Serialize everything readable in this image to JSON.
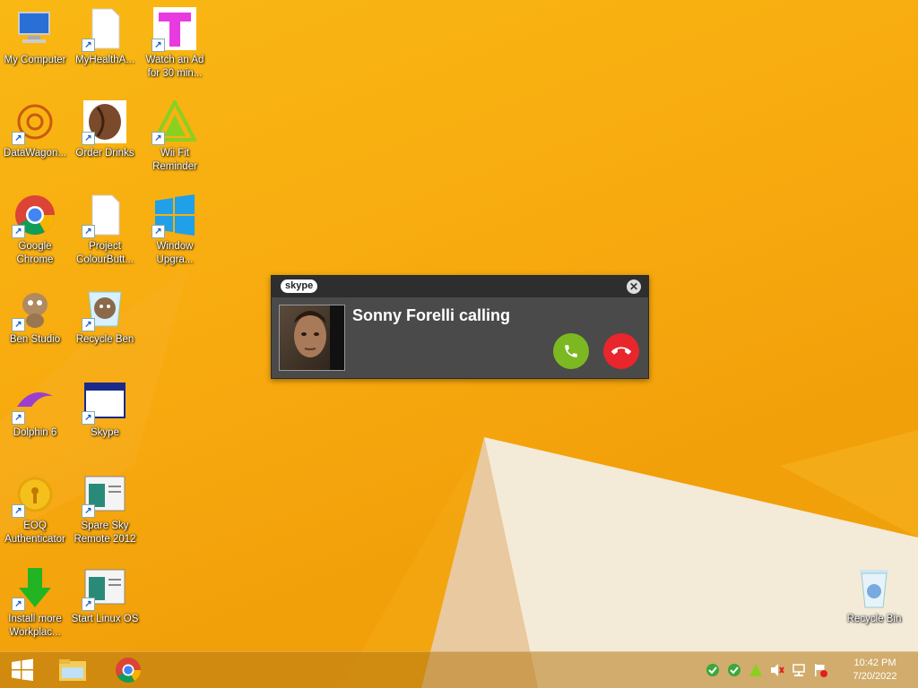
{
  "desktop": {
    "icons": [
      {
        "label": "My Computer"
      },
      {
        "label": "MyHealthA..."
      },
      {
        "label": "Watch an Ad for 30 min..."
      },
      {
        "label": "DataWagon..."
      },
      {
        "label": "Order Drinks"
      },
      {
        "label": "Wii Fit Reminder"
      },
      {
        "label": "Google Chrome"
      },
      {
        "label": "Project ColourButt..."
      },
      {
        "label": "Window Upgra..."
      },
      {
        "label": "Ben Studio"
      },
      {
        "label": "Recycle Ben"
      },
      {
        "label": "Dolphin 6"
      },
      {
        "label": "Skype"
      },
      {
        "label": "EOQ Authenticator"
      },
      {
        "label": "Spare Sky Remote 2012"
      },
      {
        "label": "Install more Workplac..."
      },
      {
        "label": "Start Linux OS"
      },
      {
        "label": "Recycle Bin"
      }
    ]
  },
  "skype_popup": {
    "logo": "skype",
    "caller_text": "Sonny Forelli calling",
    "close_glyph": "✕",
    "accept_color": "#7cb821",
    "decline_color": "#e8262c"
  },
  "taskbar": {
    "clock_time": "10:42 PM",
    "clock_date": "7/20/2022"
  }
}
